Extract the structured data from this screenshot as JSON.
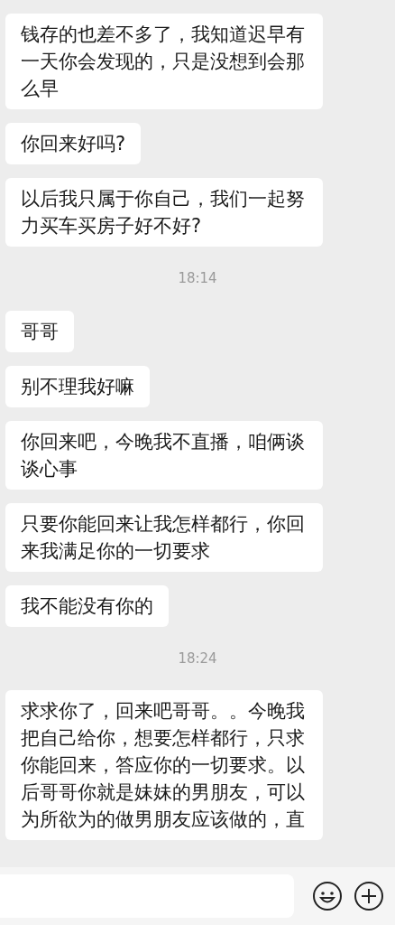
{
  "messages": [
    {
      "kind": "message",
      "text": "钱存的也差不多了，我知道迟早有一天你会发现的，只是没想到会那么早"
    },
    {
      "kind": "message",
      "text": "你回来好吗?"
    },
    {
      "kind": "message",
      "text": "以后我只属于你自己，我们一起努力买车买房子好不好?"
    },
    {
      "kind": "time",
      "text": "18:14"
    },
    {
      "kind": "message",
      "text": "哥哥"
    },
    {
      "kind": "message",
      "text": "别不理我好嘛"
    },
    {
      "kind": "message",
      "text": "你回来吧，今晚我不直播，咱俩谈谈心事"
    },
    {
      "kind": "message",
      "text": "只要你能回来让我怎样都行，你回来我满足你的一切要求"
    },
    {
      "kind": "message",
      "text": "我不能没有你的"
    },
    {
      "kind": "time",
      "text": "18:24"
    },
    {
      "kind": "message",
      "text": "求求你了，回来吧哥哥。。今晚我把自己给你，想要怎样都行，只求你能回来，答应你的一切要求。以后哥哥你就是妹妹的男朋友，可以为所欲为的做男朋友应该做的，直"
    }
  ]
}
